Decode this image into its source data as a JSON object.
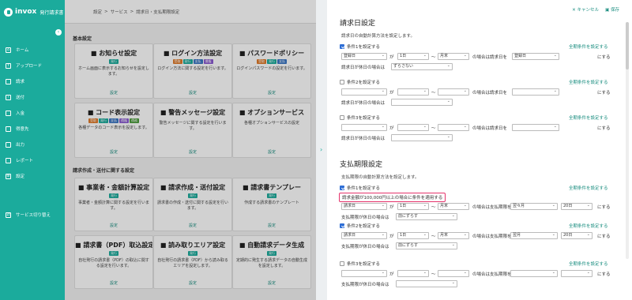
{
  "app": {
    "name": "invox",
    "subtitle": "発行請求書"
  },
  "breadcrumb": {
    "items": [
      "設定",
      "サービス",
      "請求日・支払期限設定"
    ],
    "sep": ">"
  },
  "sidebar": {
    "items": [
      {
        "label": "ホーム",
        "icon": "home-icon"
      },
      {
        "label": "アップロード",
        "icon": "upload-icon"
      },
      {
        "label": "請求",
        "icon": "invoice-icon"
      },
      {
        "label": "送付",
        "icon": "send-icon"
      },
      {
        "label": "入金",
        "icon": "deposit-icon"
      },
      {
        "label": "得意先",
        "icon": "customer-icon"
      },
      {
        "label": "出力",
        "icon": "export-icon"
      },
      {
        "label": "レポート",
        "icon": "report-icon"
      },
      {
        "label": "設定",
        "icon": "settings-icon"
      }
    ],
    "switch_label": "サービス切り替え"
  },
  "sections": {
    "basic": "基本設定",
    "invoice": "請求作成・送付に関する設定"
  },
  "cards": [
    {
      "title": "お知らせ設定",
      "badges": [
        {
          "t": "発行",
          "c": "#1bab9c"
        }
      ],
      "desc": "ホーム画面に表示するお知らせを設定します。",
      "link": "設定"
    },
    {
      "title": "ログイン方法設定",
      "badges": [
        {
          "t": "受取",
          "c": "#e07b2a"
        },
        {
          "t": "発行",
          "c": "#1bab9c"
        },
        {
          "t": "支払",
          "c": "#3a76c4"
        },
        {
          "t": "債権",
          "c": "#8a5bd1"
        }
      ],
      "desc": "ログイン方法に関する設定を行います。",
      "link": "設定"
    },
    {
      "title": "パスワードポリシー",
      "badges": [
        {
          "t": "受取",
          "c": "#e07b2a"
        },
        {
          "t": "発行",
          "c": "#1bab9c"
        },
        {
          "t": "支払",
          "c": "#3a76c4"
        }
      ],
      "desc": "ログインパスワードの設定を行います。",
      "link": "設定"
    },
    {
      "title": "コード表示設定",
      "badges": [
        {
          "t": "受取",
          "c": "#e07b2a"
        },
        {
          "t": "発行",
          "c": "#1bab9c"
        },
        {
          "t": "支払",
          "c": "#3a76c4"
        },
        {
          "t": "債権",
          "c": "#8a5bd1"
        },
        {
          "t": "債務",
          "c": "#4a9c3a"
        }
      ],
      "desc": "各種データのコード表示を設定します。",
      "link": "設定"
    },
    {
      "title": "警告メッセージ設定",
      "badges": [],
      "desc": "警告メッセージに関する設定を行います。",
      "link": "設定"
    },
    {
      "title": "オプションサービス",
      "badges": [],
      "desc": "各種オプションサービスの設定",
      "link": "設定"
    },
    {
      "title": "事業者・金額計算設定",
      "badges": [
        {
          "t": "発行",
          "c": "#1bab9c"
        }
      ],
      "desc": "事業者・金額計算に関する設定を行います。",
      "link": "設定"
    },
    {
      "title": "請求作成・送付設定",
      "badges": [
        {
          "t": "発行",
          "c": "#1bab9c"
        }
      ],
      "desc": "請求書の作成・送付に関する設定を行います。",
      "link": "設定"
    },
    {
      "title": "請求書テンプレー",
      "badges": [
        {
          "t": "発行",
          "c": "#1bab9c"
        }
      ],
      "desc": "作成する請求書のテンプレート",
      "link": "設定"
    },
    {
      "title": "請求書（PDF）取込設定",
      "badges": [
        {
          "t": "発行",
          "c": "#1bab9c"
        }
      ],
      "desc": "自社発行の請求書（PDF）の取込に関する設定を行います。",
      "link": "設定"
    },
    {
      "title": "読み取りエリア設定",
      "badges": [
        {
          "t": "発行",
          "c": "#1bab9c"
        }
      ],
      "desc": "自社発行の請求書（PDF）から読み取るエリアを設定します。",
      "link": "設定"
    },
    {
      "title": "自動請求データ生成",
      "badges": [
        {
          "t": "発行",
          "c": "#1bab9c"
        }
      ],
      "desc": "定期的に発生する請求データの自動生成を設定します。",
      "link": "設定"
    }
  ],
  "panel": {
    "cancel": "キャンセル",
    "save": "保存",
    "invoice_date": {
      "title": "請求日設定",
      "desc": "請求日の自動計算方法を設定します。",
      "conditions": [
        {
          "label": "条件1を設定する",
          "checked": true,
          "field": "登録日",
          "ga": "が",
          "from": "1日",
          "tilde": "〜",
          "to": "月末",
          "mid": "の場合は請求日を",
          "target": "登録日",
          "end": "にする",
          "holiday_label": "請求日が休日の場合は",
          "holiday": "ずらさない",
          "all_link": "全期条件を設定する"
        },
        {
          "label": "条件2を設定する",
          "checked": false,
          "field": "",
          "ga": "が",
          "from": "",
          "tilde": "〜",
          "to": "",
          "mid": "の場合は請求日を",
          "target": "",
          "end": "にする",
          "holiday_label": "請求日が休日の場合は",
          "holiday": "",
          "all_link": "全期条件を設定する"
        },
        {
          "label": "条件3を設定する",
          "checked": false,
          "field": "",
          "ga": "が",
          "from": "",
          "tilde": "〜",
          "to": "",
          "mid": "の場合は請求日を",
          "target": "",
          "end": "にする",
          "holiday_label": "請求日が休日の場合は",
          "holiday": "",
          "all_link": "全期条件を設定する"
        }
      ]
    },
    "due_date": {
      "title": "支払期限設定",
      "desc": "支払期限の自動計算方法を設定します。",
      "highlight": "請求金額が100,000円以上の場合に条件を適用する",
      "conditions": [
        {
          "label": "条件1を設定する",
          "checked": true,
          "field": "請求日",
          "ga": "が",
          "from": "1日",
          "tilde": "〜",
          "to": "月末",
          "mid": "の場合は支払期限を",
          "target": "翌々月",
          "day": "20日",
          "end": "にする",
          "holiday_label": "支払期限が休日の場合は",
          "holiday": "前にずらす",
          "all_link": "全期条件を設定する"
        },
        {
          "label": "条件2を設定する",
          "checked": true,
          "field": "請求日",
          "ga": "が",
          "from": "1日",
          "tilde": "〜",
          "to": "月末",
          "mid": "の場合は支払期限を",
          "target": "翌月",
          "day": "20日",
          "end": "にする",
          "holiday_label": "支払期限が休日の場合は",
          "holiday": "前にずらす",
          "all_link": "全期条件を設定する"
        },
        {
          "label": "条件3を設定する",
          "checked": false,
          "field": "",
          "ga": "が",
          "from": "",
          "tilde": "〜",
          "to": "",
          "mid": "の場合は支払期限を",
          "target": "",
          "day": "",
          "end": "にする",
          "holiday_label": "支払期限が休日の場合は",
          "holiday": "",
          "all_link": "全期条件を設定する"
        }
      ]
    }
  }
}
